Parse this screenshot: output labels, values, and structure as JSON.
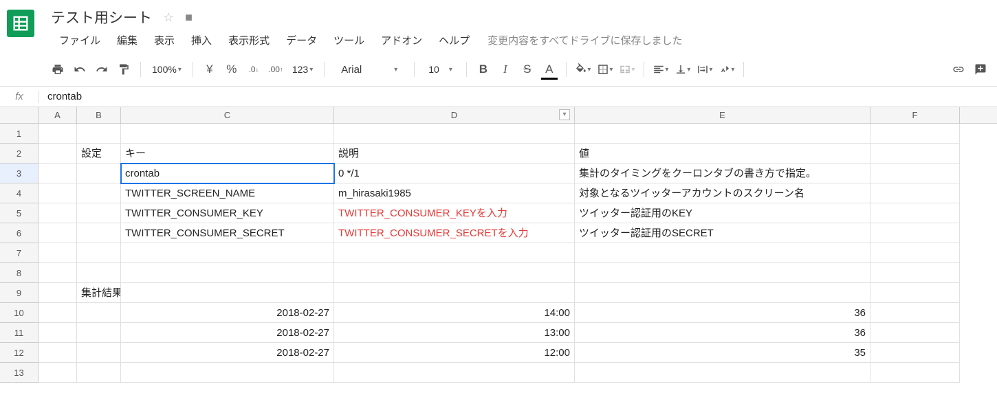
{
  "header": {
    "title": "テスト用シート",
    "save_status": "変更内容をすべてドライブに保存しました"
  },
  "menu": {
    "file": "ファイル",
    "edit": "編集",
    "view": "表示",
    "insert": "挿入",
    "format": "表示形式",
    "data": "データ",
    "tools": "ツール",
    "addons": "アドオン",
    "help": "ヘルプ"
  },
  "toolbar": {
    "zoom": "100%",
    "currency": "¥",
    "percent": "%",
    "dec_dec": ".0",
    "dec_inc": ".00",
    "more_formats": "123",
    "font": "Arial",
    "font_size": "10",
    "bold": "B",
    "italic": "I",
    "strike": "S",
    "text_color": "A"
  },
  "fx": {
    "label": "fx",
    "value": "crontab"
  },
  "columns": [
    "A",
    "B",
    "C",
    "D",
    "E",
    "F"
  ],
  "row_numbers": [
    "1",
    "2",
    "3",
    "4",
    "5",
    "6",
    "7",
    "8",
    "9",
    "10",
    "11",
    "12",
    "13"
  ],
  "cells": {
    "B2": "設定",
    "C2": "キー",
    "D2": "説明",
    "E2": "値",
    "C3": "crontab",
    "D3": "0 */1",
    "E3": "集計のタイミングをクーロンタブの書き方で指定。",
    "C4": "TWITTER_SCREEN_NAME",
    "D4": "m_hirasaki1985",
    "E4": "対象となるツイッターアカウントのスクリーン名",
    "C5": "TWITTER_CONSUMER_KEY",
    "D5": "TWITTER_CONSUMER_KEYを入力",
    "E5": "ツイッター認証用のKEY",
    "C6": "TWITTER_CONSUMER_SECRET",
    "D6": "TWITTER_CONSUMER_SECRETを入力",
    "E6": "ツイッター認証用のSECRET",
    "B9": "集計結果",
    "C10": "2018-02-27",
    "D10": "14:00",
    "E10": "36",
    "C11": "2018-02-27",
    "D11": "13:00",
    "E11": "36",
    "C12": "2018-02-27",
    "D12": "12:00",
    "E12": "35"
  }
}
